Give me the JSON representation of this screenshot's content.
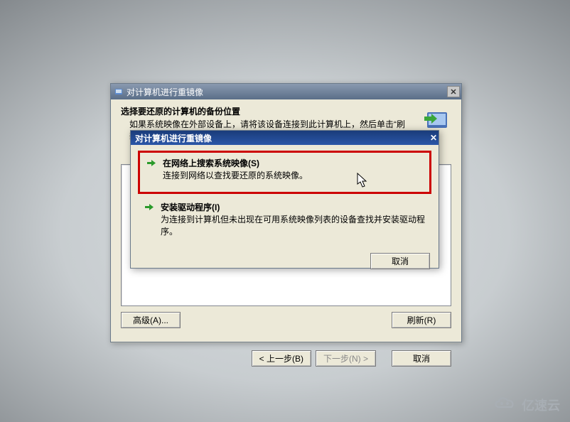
{
  "wizard": {
    "title": "对计算机进行重镜像",
    "header_title": "选择要还原的计算机的备份位置",
    "header_subtitle": "如果系统映像在外部设备上，请将该设备连接到此计算机上，然后单击“刷新”。",
    "advanced_btn": "高级(A)...",
    "refresh_btn": "刷新(R)",
    "back_btn": "< 上一步(B)",
    "next_btn": "下一步(N) >",
    "cancel_btn": "取消"
  },
  "dialog": {
    "title": "对计算机进行重镜像",
    "option1_title": "在网络上搜索系统映像(S)",
    "option1_desc": "连接到网络以查找要还原的系统映像。",
    "option2_title": "安装驱动程序(I)",
    "option2_desc": "为连接到计算机但未出现在可用系统映像列表的设备查找并安装驱动程序。",
    "cancel_btn": "取消"
  },
  "watermark": "亿速云"
}
